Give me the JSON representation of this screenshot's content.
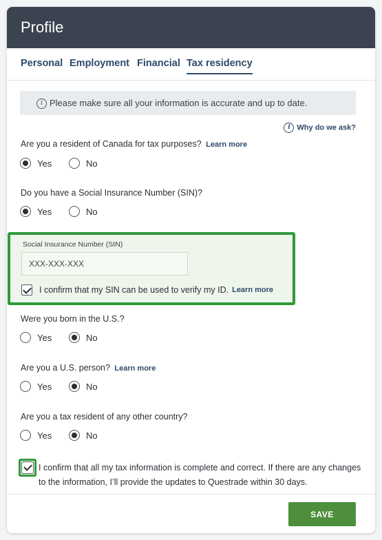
{
  "header": {
    "title": "Profile"
  },
  "tabs": [
    {
      "label": "Personal",
      "active": false
    },
    {
      "label": "Employment",
      "active": false
    },
    {
      "label": "Financial",
      "active": false
    },
    {
      "label": "Tax residency",
      "active": true
    }
  ],
  "notice": {
    "text": "Please make sure all your information is accurate and up to date."
  },
  "why_link": "Why do we ask?",
  "questions": [
    {
      "text": "Are you a resident of Canada for tax purposes?",
      "learn_more": "Learn more",
      "yes": "Yes",
      "no": "No",
      "selected": "Yes"
    },
    {
      "text": "Do you have a Social Insurance Number (SIN)?",
      "yes": "Yes",
      "no": "No",
      "selected": "Yes"
    },
    {
      "text": "Were you born in the U.S.?",
      "yes": "Yes",
      "no": "No",
      "selected": "No"
    },
    {
      "text": "Are you a U.S. person?",
      "learn_more": "Learn more",
      "yes": "Yes",
      "no": "No",
      "selected": "No"
    },
    {
      "text": "Are you a tax resident of any other country?",
      "yes": "Yes",
      "no": "No",
      "selected": "No"
    }
  ],
  "sin": {
    "label": "Social Insurance Number (SIN)",
    "value": "XXX-XXX-XXX",
    "confirm_text": "I confirm that my SIN can be used to verify my ID.",
    "learn_more": "Learn more",
    "checked": true
  },
  "final_confirm": {
    "text": "I confirm that all my tax information is complete and correct. If there are any changes to the information, I’ll provide the updates to Questrade within 30 days.",
    "checked": true
  },
  "footer": {
    "save_label": "SAVE"
  },
  "colors": {
    "header_bg": "#3b4351",
    "accent": "#2d4a6b",
    "highlight": "#2f9a3a",
    "save_bg": "#4e8f3e"
  }
}
